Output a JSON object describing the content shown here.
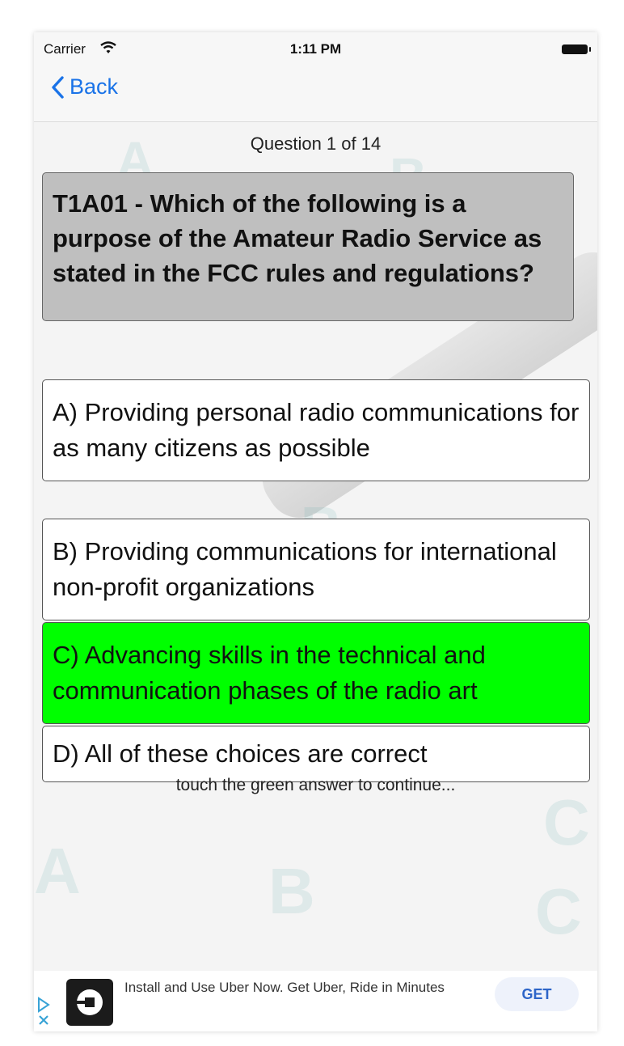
{
  "status_bar": {
    "carrier": "Carrier",
    "time": "1:11 PM"
  },
  "nav": {
    "back_label": "Back"
  },
  "quiz": {
    "counter": "Question 1 of 14",
    "question": "T1A01 - Which of the following is a purpose of the Amateur Radio Service as stated in the FCC rules and regulations?",
    "answers": [
      {
        "text": "A) Providing personal radio communications for as many citizens as possible",
        "state": "default"
      },
      {
        "text": "B) Providing communications for international non-profit organizations",
        "state": "default"
      },
      {
        "text": "C) Advancing skills in the technical and communication phases of the radio art",
        "state": "correct"
      },
      {
        "text": "D) All of these choices are correct",
        "state": "default"
      }
    ],
    "hint": "touch the green answer to continue..."
  },
  "ad": {
    "text": "Install and Use Uber Now. Get Uber, Ride in Minutes",
    "cta": "GET"
  },
  "background_letters": [
    "A",
    "B",
    "A",
    "B",
    "C",
    "A",
    "B",
    "C"
  ],
  "colors": {
    "back_link": "#1a73e8",
    "question_bg": "#bfbfbf",
    "answer_bg": "#ffffff",
    "correct_bg": "#00ff00",
    "cta_bg": "#eef2fb",
    "cta_text": "#2d65c8"
  },
  "icons": [
    "wifi-icon",
    "battery-icon",
    "chevron-left-icon",
    "adchoices-icon",
    "uber-logo"
  ]
}
